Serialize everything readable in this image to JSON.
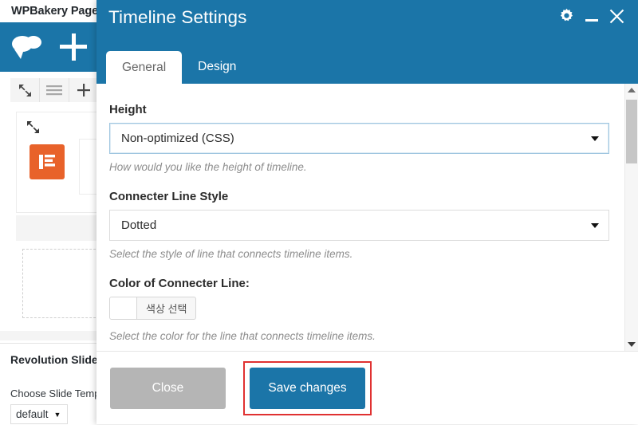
{
  "background_app": {
    "title": "WPBakery Page",
    "logo_icon": "cloud-icon",
    "add_icon": "plus-icon",
    "toolbar_icons": [
      "expand-arrows-icon",
      "hamburger-icon",
      "plus-icon"
    ],
    "element_icon": "text-block-icon",
    "element_icon_color": "#e8622a",
    "panel": {
      "title": "Revolution Slide",
      "field_label": "Choose Slide Temp",
      "select_value": "default",
      "select_caret": "chevron-down-icon"
    }
  },
  "modal": {
    "title": "Timeline Settings",
    "header_color": "#1b75a8",
    "controls": [
      {
        "name": "gear-icon",
        "label": "Settings"
      },
      {
        "name": "minimize-icon",
        "label": "Minimize"
      },
      {
        "name": "close-icon",
        "label": "Close"
      }
    ],
    "tabs": [
      {
        "label": "General",
        "active": true
      },
      {
        "label": "Design",
        "active": false
      }
    ],
    "fields": [
      {
        "label": "Height",
        "value": "Non-optimized (CSS)",
        "description": "How would you like the height of timeline.",
        "focused": true
      },
      {
        "label": "Connecter Line Style",
        "value": "Dotted",
        "description": "Select the style of line that connects timeline items.",
        "focused": false
      }
    ],
    "color_field": {
      "label": "Color of Connecter Line:",
      "button_label": "색상 선택",
      "swatch_color": "#ffffff",
      "description": "Select the color for the line that connects timeline items."
    },
    "footer": {
      "close_label": "Close",
      "save_label": "Save changes",
      "close_color": "#b5b5b5",
      "save_color": "#1b75a8",
      "highlight_color": "#e03131"
    },
    "scrollbar": {
      "up_arrow": "caret-up-icon",
      "down_arrow": "caret-down-icon"
    }
  }
}
